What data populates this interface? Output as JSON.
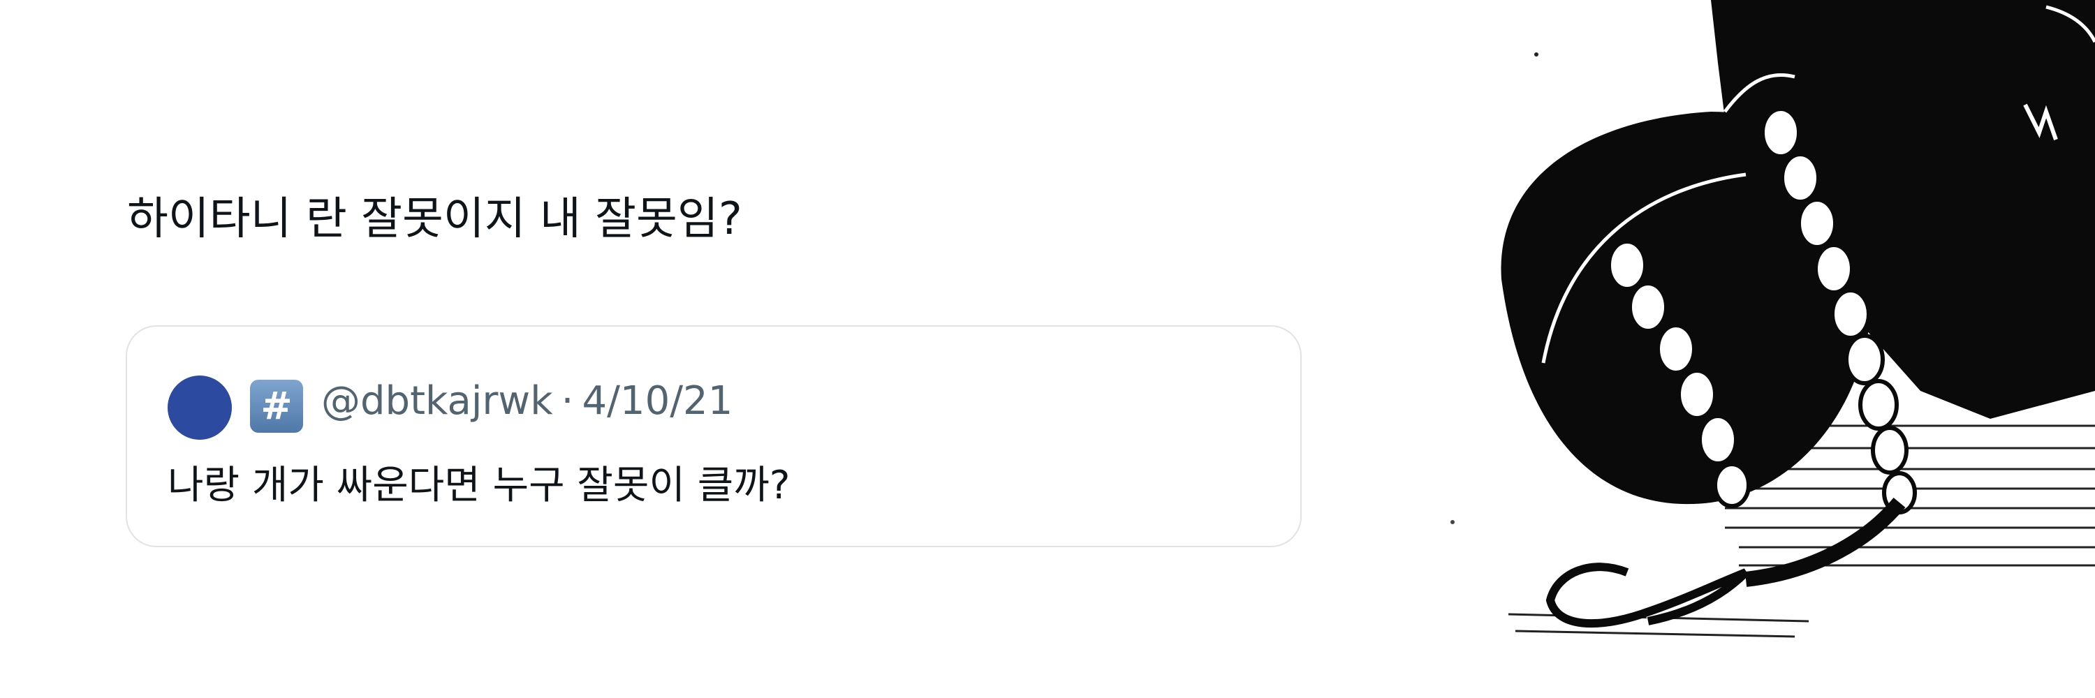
{
  "post": {
    "text": "하이타니 란 잘못이지 내 잘못임?"
  },
  "quoted_tweet": {
    "badge_icon": "hash-keycap-icon",
    "badge_symbol": "#",
    "handle": "@dbtkajrwk",
    "separator": "·",
    "date": "4/10/21",
    "text": "나랑 개가 싸운다면 누구 잘못이 클까?",
    "avatar_color": "#2b4aa0"
  },
  "image": {
    "subject": "manga-character-bowing-illustration"
  }
}
